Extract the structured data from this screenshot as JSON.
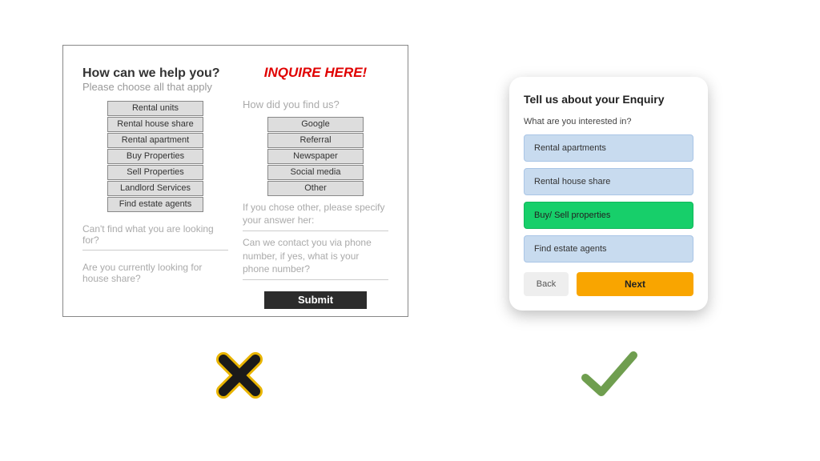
{
  "leftForm": {
    "heading": "How can we help you?",
    "subheading": "Please choose all that apply",
    "options": [
      "Rental units",
      "Rental house share",
      "Rental apartment",
      "Buy Properties",
      "Sell Properties",
      "Landlord Services",
      "Find estate agents"
    ],
    "prompt1": "Can't find what you are looking for?",
    "prompt2": "Are you currently looking for house share?",
    "inquireHeading": "INQUIRE HERE!",
    "findUsQ": "How did you find us?",
    "findUsOptions": [
      "Google",
      "Referral",
      "Newspaper",
      "Social media",
      "Other"
    ],
    "otherPrompt": "If you chose other, please specify your answer her:",
    "contactPrompt": "Can we contact you via phone number, if yes, what is your phone number?",
    "submit": "Submit"
  },
  "rightCard": {
    "title": "Tell us about your Enquiry",
    "question": "What are you interested in?",
    "options": {
      "opt1": "Rental apartments",
      "opt2": "Rental house share",
      "opt3": "Buy/ Sell properties",
      "opt4": "Find estate agents"
    },
    "back": "Back",
    "next": "Next"
  }
}
